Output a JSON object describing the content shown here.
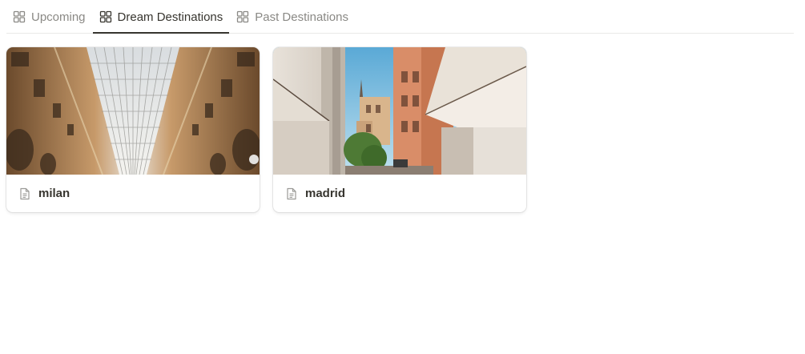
{
  "tabs": [
    {
      "label": "Upcoming",
      "icon": "gallery-icon",
      "active": false
    },
    {
      "label": "Dream Destinations",
      "icon": "gallery-icon",
      "active": true
    },
    {
      "label": "Past Destinations",
      "icon": "gallery-icon",
      "active": false
    }
  ],
  "cards": [
    {
      "title": "milan",
      "icon": "page-icon",
      "cover": "milan-galleria-photo"
    },
    {
      "title": "madrid",
      "icon": "page-icon",
      "cover": "madrid-street-photo"
    }
  ],
  "colors": {
    "text": "#37352f",
    "muted": "#8a8985",
    "divider": "#e9e9e7"
  }
}
